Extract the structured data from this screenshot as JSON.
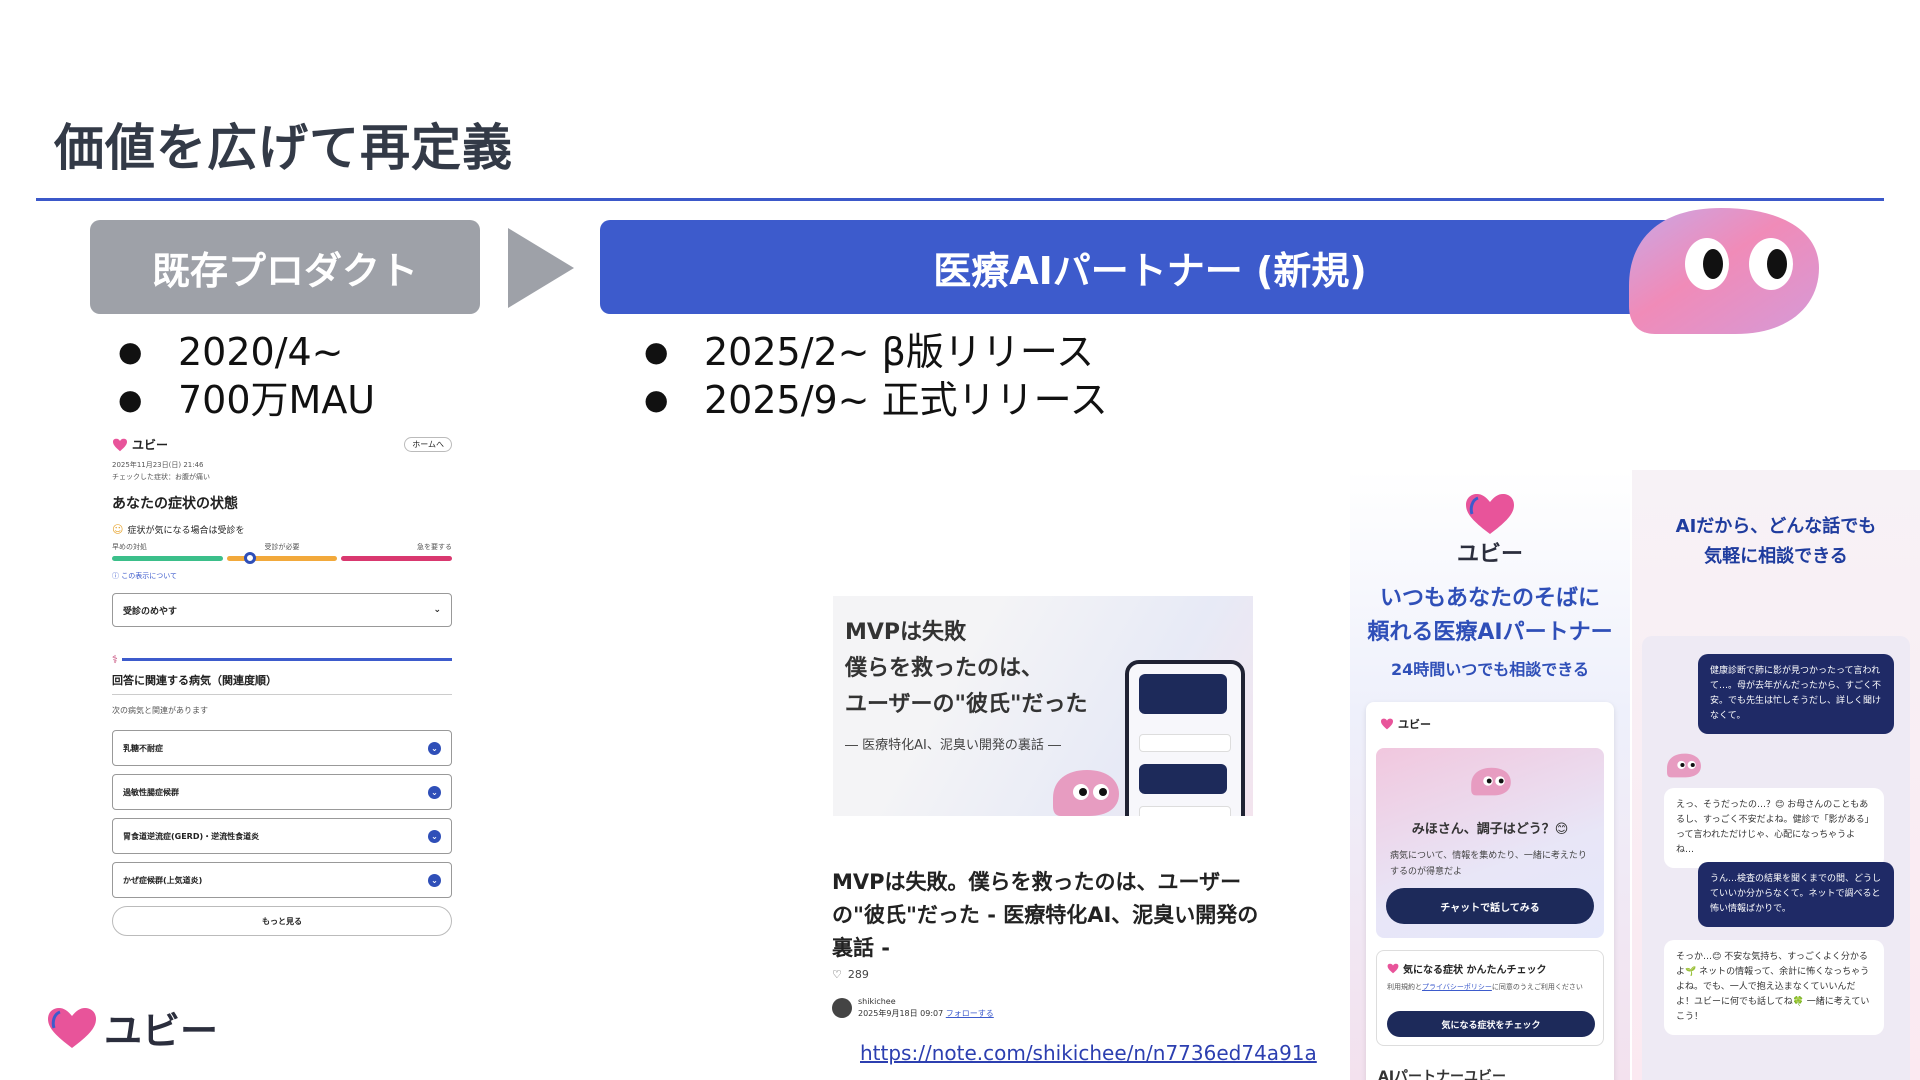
{
  "slide": {
    "title": "価値を広げて再定義"
  },
  "colors": {
    "accent": "#3d5bcc",
    "gray": "#9ea1a8",
    "navy": "#1d2a5a",
    "pink": "#e8549a"
  },
  "existing": {
    "label": "既存プロダクト",
    "bullets": [
      "2020/4~",
      "700万MAU"
    ],
    "screenshot": {
      "brand": "ユビー",
      "home_button": "ホームへ",
      "date": "2025年11月23日(日) 21:46",
      "checked": "チェックした症状：お腹が痛い",
      "heading": "あなたの症状の状態",
      "advice": "症状が気になる場合は受診を",
      "scale_labels": [
        "早めの対処",
        "受診が必要",
        "急を要する"
      ],
      "about_label": "この表示について",
      "select_label": "受診のめやす",
      "section_title": "回答に関連する病気（関連度順）",
      "section_sub": "次の病気と関連があります",
      "diseases": [
        "乳糖不耐症",
        "過敏性腸症候群",
        "胃食道逆流症(GERD)・逆流性食道炎",
        "かぜ症候群(上気道炎)"
      ],
      "more_button": "もっと見る"
    }
  },
  "new_product": {
    "label": "医療AIパートナー (新規)",
    "bullets": [
      "2025/2~ β版リリース",
      "2025/9~ 正式リリース"
    ]
  },
  "article": {
    "image_lines": [
      "MVPは失敗",
      "僕らを救ったのは、",
      "ユーザーの\"彼氏\"だった"
    ],
    "image_sub": "― 医療特化AI、泥臭い開発の裏話 ―",
    "title": "MVPは失敗。僕らを救ったのは、ユーザーの\"彼氏\"だった - 医療特化AI、泥臭い開発の裏話 -",
    "likes": "289",
    "author": "shikichee",
    "date": "2025年9月18日 09:07",
    "follow": "フォローする",
    "link": "https://note.com/shikichee/n/n7736ed74a91a"
  },
  "app_promo": {
    "brand": "ユビー",
    "headline_1": "いつもあなたのそばに",
    "headline_2": "頼れる医療AIパートナー",
    "sub": "24時間いつでも相談できる",
    "card_brand": "ユビー",
    "greeting": "みほさん、調子はどう？😊",
    "description": "病気について、情報を集めたり、一緒に考えたりするのが得意だよ",
    "chat_button": "チャットで話してみる",
    "check_title": "気になる症状 かんたんチェック",
    "check_note_1": "利用規約と",
    "check_note_privacy": "プライバシーポリシー",
    "check_note_2": "に同意のうえご利用ください",
    "check_button": "気になる症状をチェック",
    "footer": "AIパートナーユビー"
  },
  "chat_promo": {
    "headline_1": "AIだから、どんな話でも",
    "headline_2": "気軽に相談できる",
    "messages": [
      {
        "role": "user",
        "text": "健康診断で肺に影が見つかったって言われて…。母が去年がんだったから、すごく不安。でも先生は忙しそうだし、詳しく聞けなくて。"
      },
      {
        "role": "ai",
        "text": "えっ、そうだったの…？😊 お母さんのこともあるし、すっごく不安だよね。健診で「影がある」って言われただけじゃ、心配になっちゃうよね…"
      },
      {
        "role": "user",
        "text": "うん…検査の結果を聞くまでの間、どうしていいか分からなくて。ネットで調べると怖い情報ばかりで。"
      },
      {
        "role": "ai",
        "text": "そっか…😊 不安な気持ち、すっごくよく分かるよ🌱 ネットの情報って、余計に怖くなっちゃうよね。でも、一人で抱え込まなくていいんだよ！ユビーに何でも話してね🍀 一緒に考えていこう！"
      }
    ]
  }
}
